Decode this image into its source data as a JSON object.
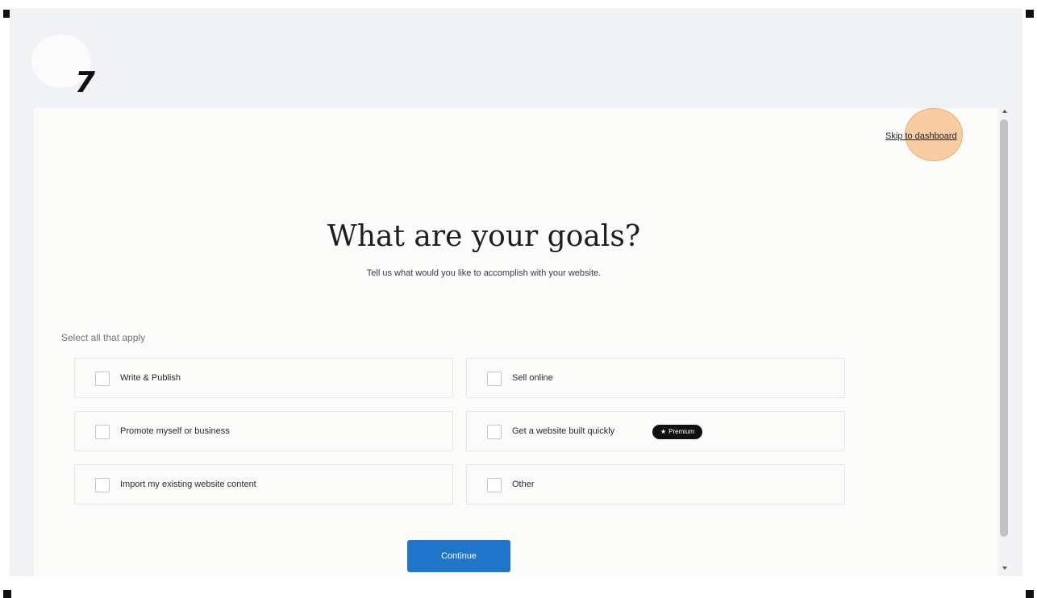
{
  "step": {
    "number": "7"
  },
  "header": {
    "skip_label": "Skip to dashboard"
  },
  "main": {
    "title": "What are your goals?",
    "subtitle": "Tell us what would you like to accomplish with your website.",
    "select_hint": "Select all that apply"
  },
  "goals": [
    {
      "label": "Write & Publish",
      "checked": false
    },
    {
      "label": "Sell online",
      "checked": false
    },
    {
      "label": "Promote myself or business",
      "checked": false
    },
    {
      "label": "Get a website built quickly",
      "checked": false,
      "badge": "Premium"
    },
    {
      "label": "Import my existing website content",
      "checked": false
    },
    {
      "label": "Other",
      "checked": false
    }
  ],
  "actions": {
    "continue_label": "Continue"
  },
  "colors": {
    "primary_button": "#1e75c9",
    "badge_background": "#101010",
    "click_marker": "#f7b06e",
    "page_background": "#f0f2f6"
  },
  "icons": {
    "badge_icon": "star-icon"
  }
}
